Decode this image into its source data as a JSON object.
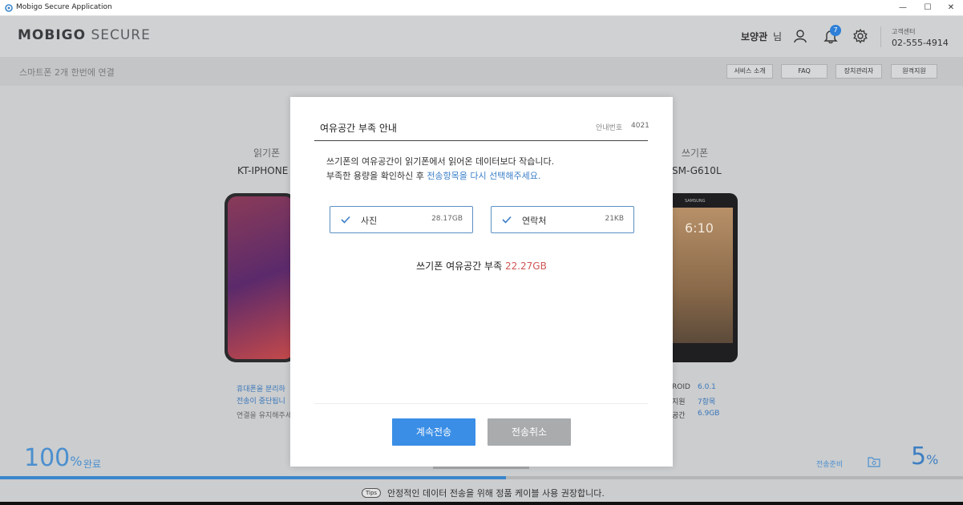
{
  "window": {
    "title": "Mobigo Secure Application",
    "minimize": "—",
    "maximize": "☐",
    "close": "✕"
  },
  "header": {
    "logo_bold": "MOBIGO",
    "logo_light": " SECURE",
    "user_name": "보양관",
    "user_suffix": "님",
    "notification_count": "7",
    "support_label": "고객센터",
    "support_phone": "02-555-4914"
  },
  "subbar": {
    "title": "스마트폰 2개 한번에 연결",
    "nav": [
      "서비스 소개",
      "FAQ",
      "장치관리자",
      "원격지원"
    ]
  },
  "source_phone": {
    "label": "읽기폰",
    "model": "KT-IPHONE",
    "info1": "휴대폰을 분리하",
    "info2": "전송이 중단됩니",
    "info3": "연결을 유지해주세"
  },
  "target_phone": {
    "label": "쓰기폰",
    "model": "SM-G610L",
    "clock": "6:10",
    "brand": "SAMSUNG",
    "spec_rows": [
      {
        "label": "ROID",
        "value": "6.0.1"
      },
      {
        "label": "지원",
        "value": "7항목"
      },
      {
        "label": "공간",
        "value": "6.9GB"
      }
    ]
  },
  "status": {
    "left_percent": "100",
    "percent_unit": "%",
    "left_label": "완료",
    "right_label": "전송준비",
    "right_percent": "5",
    "progress_fraction": 0.525
  },
  "tips": {
    "badge": "Tips",
    "text": "안정적인 데이터 전송을 위해 정품 케이블 사용 권장합니다."
  },
  "modal": {
    "title": "여유공간 부족 안내",
    "ref_label": "안내번호",
    "ref_number": "4021",
    "message_line1": "쓰기폰의 여유공간이 읽기폰에서 읽어온 데이터보다 작습니다.",
    "message_line2_prefix": "부족한 용량을 확인하신 후 ",
    "message_line2_link": "전송항목을 다시 선택해주세요.",
    "items": [
      {
        "name": "사진",
        "size": "28.17GB"
      },
      {
        "name": "연락처",
        "size": "21KB"
      }
    ],
    "shortage_label": "쓰기폰 여유공간 부족 ",
    "shortage_amount": "22.27GB",
    "continue_label": "계속전송",
    "cancel_label": "전송취소"
  },
  "colors": {
    "accent": "#3a8ee6",
    "warning": "#d05656",
    "disabled_button": "#a9abad"
  }
}
